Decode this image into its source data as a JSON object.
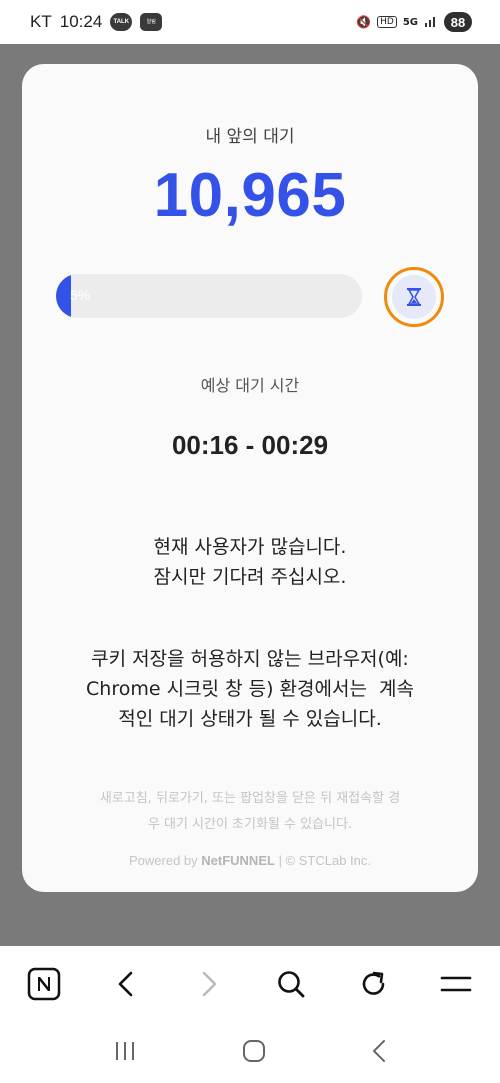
{
  "status_bar": {
    "carrier": "KT",
    "time": "10:24",
    "talk_badge": "TALK",
    "app_badge": "알림",
    "network": "5G",
    "hd": "HD",
    "battery": "88"
  },
  "queue": {
    "label": "내 앞의 대기",
    "count": "10,965",
    "progress_text": "5%",
    "progress_value": 0.05
  },
  "eta": {
    "label": "예상 대기 시간",
    "value": "00:16 - 00:29"
  },
  "messages": {
    "line1": "현재 사용자가 많습니다.",
    "line2": "잠시만 기다려 주십시오.",
    "cookie_line1": "쿠키 저장을 허용하지 않는 브라우저(예:",
    "cookie_line2": "Chrome 시크릿 창 등) 환경에서는  계속",
    "cookie_line3": "적인 대기 상태가 될 수 있습니다."
  },
  "notice": {
    "line1": "새로고침, 뒤로가기, 또는 팝업창을 닫은 뒤 재접속할 경",
    "line2": "우 대기 시간이 초기화될 수 있습니다."
  },
  "footer": {
    "powered": "Powered by",
    "brand": "NetFUNNEL",
    "copyright": "| © STCLab Inc."
  },
  "colors": {
    "accent": "#3451e8",
    "ring": "#f08a0c"
  },
  "toolbar": {
    "icons": [
      "naver-icon",
      "back-icon",
      "forward-icon",
      "search-icon",
      "refresh-icon",
      "menu-icon"
    ]
  },
  "system_nav": {
    "icons": [
      "recent-apps-icon",
      "home-icon",
      "system-back-icon"
    ]
  }
}
